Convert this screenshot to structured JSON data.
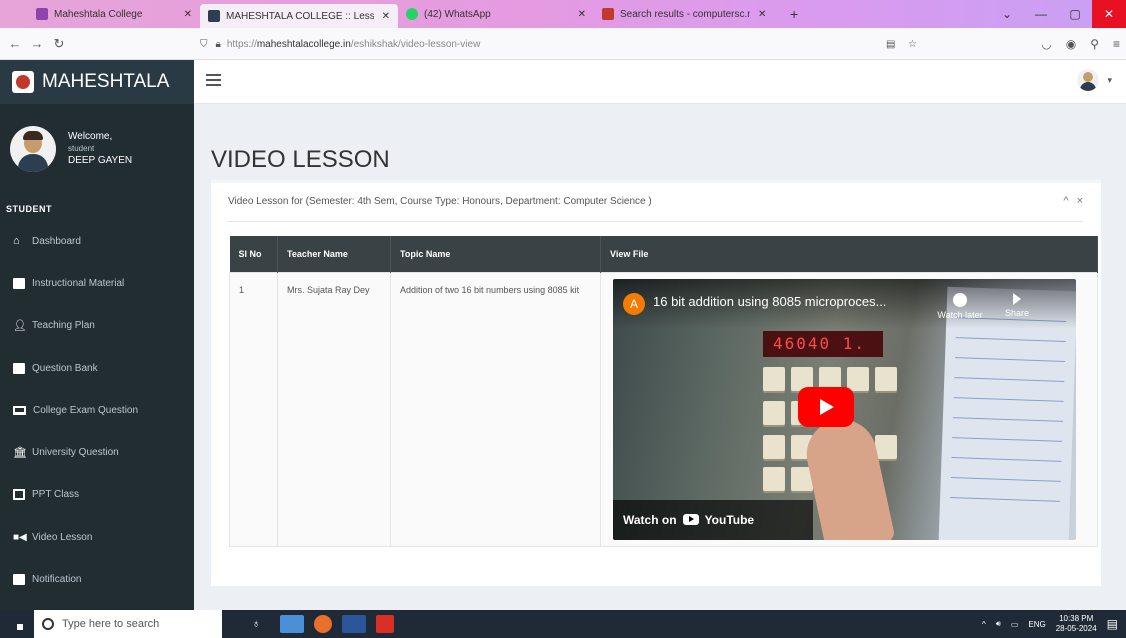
{
  "browser": {
    "tabs": [
      {
        "title": "Maheshtala College",
        "active": false,
        "color": "#8e44ad"
      },
      {
        "title": "MAHESHTALA COLLEGE :: Lesso",
        "active": true,
        "color": "#2c3e50"
      },
      {
        "title": "(42) WhatsApp",
        "active": false,
        "color": "#25d366"
      },
      {
        "title": "Search results - computersc.m",
        "active": false,
        "color": "#c0392b"
      }
    ],
    "url_prefix": "https://",
    "url_domain": "maheshtalacollege.in",
    "url_path": "/eshikshak/video-lesson-view"
  },
  "sidebar": {
    "brand": "MAHESHTALA",
    "welcome": "Welcome,",
    "role": "student",
    "username": "DEEP GAYEN",
    "section": "STUDENT",
    "items": [
      {
        "label": "Dashboard",
        "icon": "home-icon"
      },
      {
        "label": "Instructional Material",
        "icon": "file-icon"
      },
      {
        "label": "Teaching Plan",
        "icon": "user-icon"
      },
      {
        "label": "Question Bank",
        "icon": "file-icon"
      },
      {
        "label": "College Exam Question",
        "icon": "laptop-icon"
      },
      {
        "label": "University Question",
        "icon": "institution-icon"
      },
      {
        "label": "PPT Class",
        "icon": "image-icon"
      },
      {
        "label": "Video Lesson",
        "icon": "video-icon"
      },
      {
        "label": "Notification",
        "icon": "file-icon"
      }
    ]
  },
  "main": {
    "title": "VIDEO LESSON",
    "box_title": "Video Lesson for (Semester: 4th Sem, Course Type: Honours, Department: Computer Science )",
    "collapse": "^",
    "remove": "×",
    "table": {
      "headers": [
        "Sl No",
        "Teacher Name",
        "Topic Name",
        "View File"
      ],
      "rows": [
        {
          "sl": "1",
          "teacher": "Mrs. Sujata Ray Dey",
          "topic": "Addition of two 16 bit numbers using 8085 kit"
        }
      ]
    },
    "video": {
      "channel_initial": "A",
      "title": "16 bit addition using 8085 microproces...",
      "display": "46040 1.",
      "watch_later": "Watch later",
      "share": "Share",
      "watch_on": "Watch on",
      "youtube": "YouTube"
    }
  },
  "taskbar": {
    "search_placeholder": "Type here to search",
    "lang": "ENG",
    "time": "10:38 PM",
    "date": "28-05-2024"
  }
}
